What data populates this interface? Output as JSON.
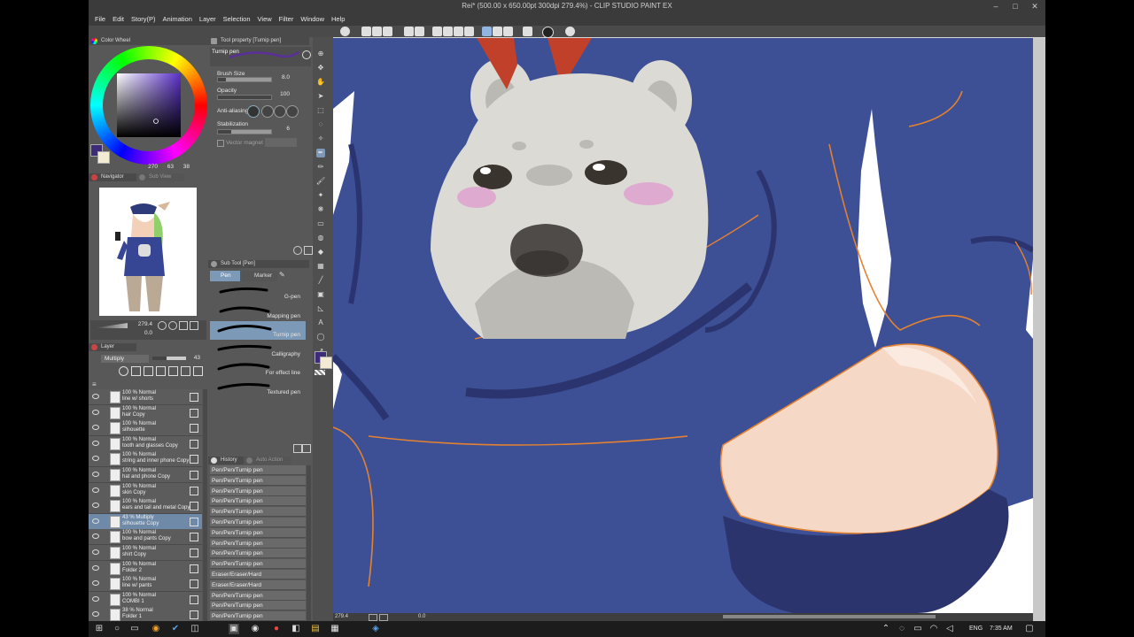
{
  "window": {
    "title": "Rei* (500.00 x 650.00pt 300dpi 279.4%) - CLIP STUDIO PAINT EX",
    "controls": [
      "–",
      "□",
      "✕"
    ]
  },
  "menu": [
    "File",
    "Edit",
    "Story(P)",
    "Animation",
    "Layer",
    "Selection",
    "View",
    "Filter",
    "Window",
    "Help"
  ],
  "panels": {
    "color_wheel": {
      "tab": "Color Wheel",
      "readout": [
        "270",
        "63",
        "38"
      ],
      "main_color": "#3d2a78",
      "sub_color": "#f2ead2"
    },
    "navigator": {
      "tab": "Navigator",
      "tab2": "Sub View",
      "zoom": "279.4",
      "rotation": "0.0"
    },
    "tool_property": {
      "tab": "Tool property [Turnip pen]",
      "tool_name": "Turnip pen",
      "brush_size_label": "Brush Size",
      "brush_size": "8.0",
      "opacity_label": "Opacity",
      "opacity": "100",
      "opacity_level": 1.0,
      "brush_size_level": 0.15,
      "anti_aliasing_label": "Anti-aliasing",
      "stabilization_label": "Stabilization",
      "stabilization": "6",
      "stabilization_level": 0.25,
      "vector_magnet_label": "Vector magnet"
    },
    "sub_tool": {
      "tab": "Sub Tool [Pen]",
      "tabs": [
        "Pen",
        "Marker"
      ],
      "brushes": [
        "G-pen",
        "Mapping pen",
        "Turnip pen",
        "Calligraphy",
        "For effect line",
        "Textured pen"
      ],
      "selected_index": 2
    },
    "layer": {
      "tab": "Layer",
      "blend_mode": "Multiply",
      "opacity": "43",
      "rows": [
        {
          "top": "100 % Normal",
          "name": "line w/ shorts"
        },
        {
          "top": "100 % Normal",
          "name": "hair Copy"
        },
        {
          "top": "100 % Normal",
          "name": "silhouette"
        },
        {
          "top": "100 % Normal",
          "name": "tooth and glasses Copy"
        },
        {
          "top": "100 % Normal",
          "name": "string and inner phone Copy"
        },
        {
          "top": "100 % Normal",
          "name": "hat and phone Copy"
        },
        {
          "top": "100 % Normal",
          "name": "skin Copy"
        },
        {
          "top": "100 % Normal",
          "name": "ears and tail and metal Copy"
        },
        {
          "top": "43 % Multiply",
          "name": "silhouette Copy"
        },
        {
          "top": "100 % Normal",
          "name": "bow and pants Copy"
        },
        {
          "top": "100 % Normal",
          "name": "shirt Copy"
        },
        {
          "top": "100 % Normal",
          "name": "Folder 2"
        },
        {
          "top": "100 % Normal",
          "name": "line w/ pants"
        },
        {
          "top": "100 % Normal",
          "name": "COMBI 1"
        },
        {
          "top": "38 % Normal",
          "name": "Folder 1"
        }
      ],
      "selected_index": 8
    },
    "history": {
      "tab": "History",
      "tab2": "Auto Action",
      "rows": [
        "Pen/Pen/Turnip pen",
        "Pen/Pen/Turnip pen",
        "Pen/Pen/Turnip pen",
        "Pen/Pen/Turnip pen",
        "Pen/Pen/Turnip pen",
        "Pen/Pen/Turnip pen",
        "Pen/Pen/Turnip pen",
        "Pen/Pen/Turnip pen",
        "Pen/Pen/Turnip pen",
        "Pen/Pen/Turnip pen",
        "Eraser/Eraser/Hard",
        "Eraser/Eraser/Hard",
        "Pen/Pen/Turnip pen",
        "Pen/Pen/Turnip pen",
        "Pen/Pen/Turnip pen",
        "Pen/Pen/Turnip pen"
      ],
      "selected_index": 15
    }
  },
  "canvas": {
    "status_zoom": "279.4",
    "status_x": "0.0",
    "bg_color": "#3d4f95"
  },
  "taskbar": {
    "lang": "ENG",
    "time": "7:35 AM"
  }
}
